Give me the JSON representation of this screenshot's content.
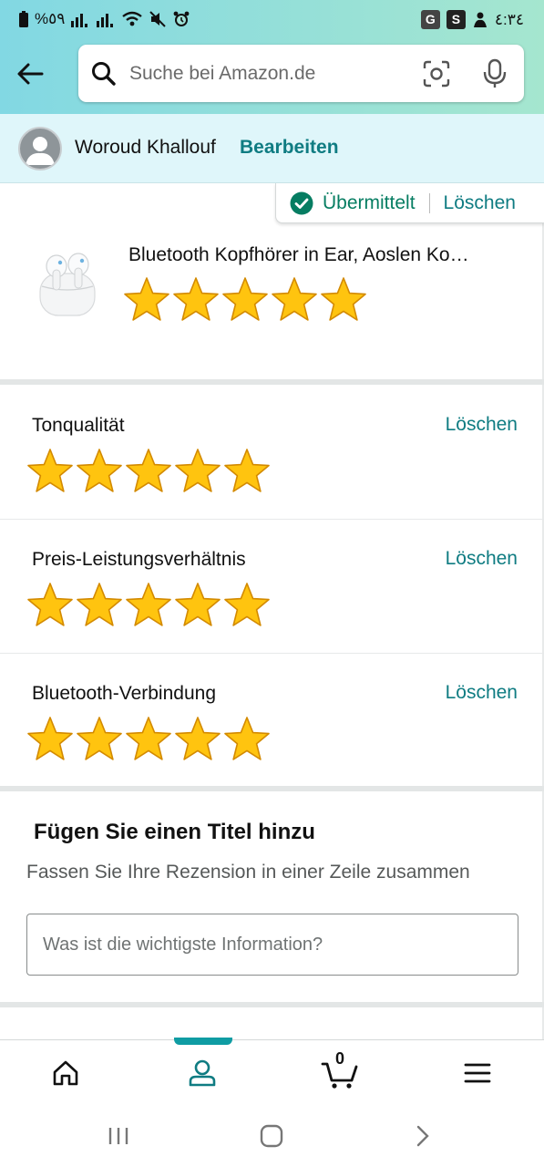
{
  "status_bar": {
    "battery": "%٥٩",
    "time": "٤:٣٤"
  },
  "search": {
    "placeholder": "Suche bei Amazon.de"
  },
  "profile": {
    "name": "Woroud Khallouf",
    "edit_label": "Bearbeiten"
  },
  "submission": {
    "status": "Übermittelt",
    "delete_label": "Löschen"
  },
  "product": {
    "title": "Bluetooth Kopfhörer in Ear, Aoslen Ko…",
    "rating": 5
  },
  "attributes": [
    {
      "label": "Tonqualität",
      "delete_label": "Löschen",
      "rating": 5
    },
    {
      "label": "Preis-Leistungsverhältnis",
      "delete_label": "Löschen",
      "rating": 5
    },
    {
      "label": "Bluetooth-Verbindung",
      "delete_label": "Löschen",
      "rating": 5
    }
  ],
  "title_section": {
    "heading": "Fügen Sie einen Titel hinzu",
    "subheading": "Fassen Sie Ihre Rezension in einer Zeile zusammen",
    "placeholder": "Was ist die wichtigste Information?"
  },
  "bottom_nav": {
    "active": "account",
    "cart_count": "0"
  },
  "colors": {
    "link": "#0f7c82",
    "success": "#067d62",
    "star_fill": "#ffc40f",
    "star_stroke": "#d38a00",
    "nav_accent": "#0f9ca3"
  }
}
